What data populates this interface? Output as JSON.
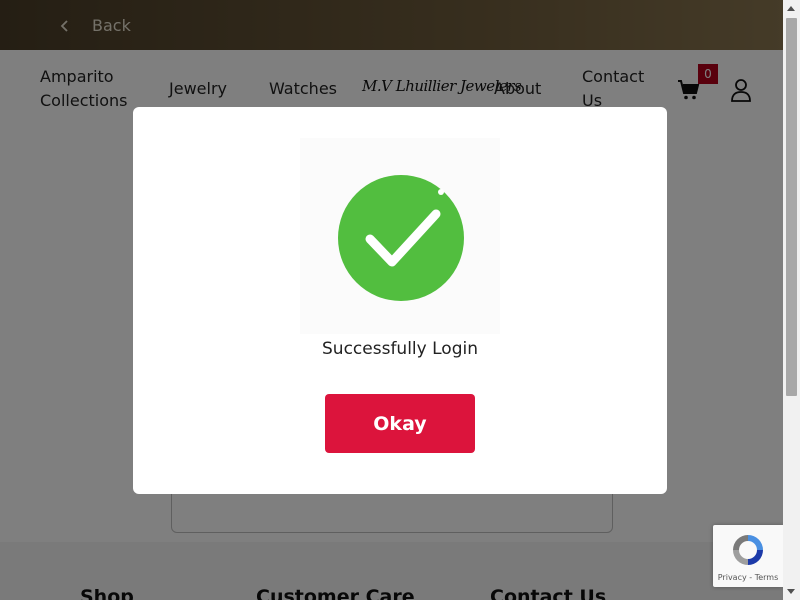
{
  "topbar": {
    "back_label": "Back"
  },
  "nav": {
    "items": [
      "Amparito Collections",
      "Jewelry",
      "Watches",
      "About",
      "Contact Us"
    ],
    "logo_text": "M.V Lhuillier Jewelers",
    "cart_count": "0"
  },
  "footer": {
    "headings": [
      "Shop",
      "Customer Care",
      "Contact Us"
    ]
  },
  "recaptcha": {
    "label": "Privacy - Terms"
  },
  "modal": {
    "message": "Successfully Login",
    "button_label": "Okay"
  },
  "colors": {
    "accent": "#dc143c",
    "success": "#52be3f",
    "badge": "#b3001b"
  },
  "icons": [
    "chevron-left-icon",
    "cart-icon",
    "user-icon",
    "check-circle-icon",
    "recaptcha-icon"
  ]
}
